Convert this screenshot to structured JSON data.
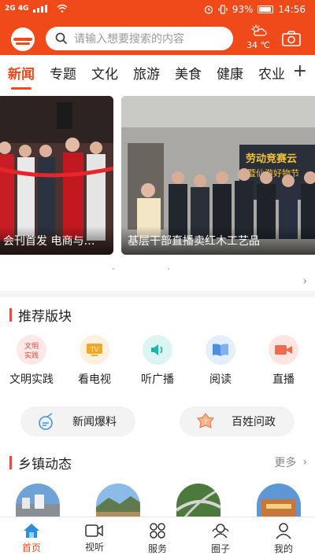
{
  "status_bar": {
    "network": "2G 4G",
    "battery": "93%",
    "time": "14:56"
  },
  "header": {
    "search_placeholder": "请输入想要搜索的内容",
    "weather_temp": "34 ℃"
  },
  "tabs": [
    "新闻",
    "专题",
    "文化",
    "旅游",
    "美食",
    "健康",
    "农业"
  ],
  "active_tab": "新闻",
  "banners": [
    {
      "caption": "会刊首发 电商与…"
    },
    {
      "caption": "基层干部直播卖红木工艺品"
    }
  ],
  "recommend": {
    "title": "推荐版块",
    "items": [
      {
        "label": "文明实践",
        "icon": "civilization-practice-icon",
        "icon_text": "文明\n实践"
      },
      {
        "label": "看电视",
        "icon": "tv-icon",
        "icon_text": "TV"
      },
      {
        "label": "听广播",
        "icon": "radio-icon"
      },
      {
        "label": "阅读",
        "icon": "book-icon"
      },
      {
        "label": "直播",
        "icon": "live-camera-icon"
      }
    ],
    "pills": [
      {
        "label": "新闻爆料",
        "icon": "news-tip-icon"
      },
      {
        "label": "百姓问政",
        "icon": "public-inquiry-icon"
      }
    ]
  },
  "town": {
    "title": "乡镇动态",
    "more": "更多"
  },
  "bottom_nav": [
    {
      "label": "首页",
      "icon": "home-icon"
    },
    {
      "label": "视听",
      "icon": "video-icon"
    },
    {
      "label": "服务",
      "icon": "grid-services-icon"
    },
    {
      "label": "圈子",
      "icon": "community-icon"
    },
    {
      "label": "我的",
      "icon": "profile-icon"
    }
  ],
  "colors": {
    "brand": "#f04a1b",
    "accent_red": "#e74c3c"
  }
}
